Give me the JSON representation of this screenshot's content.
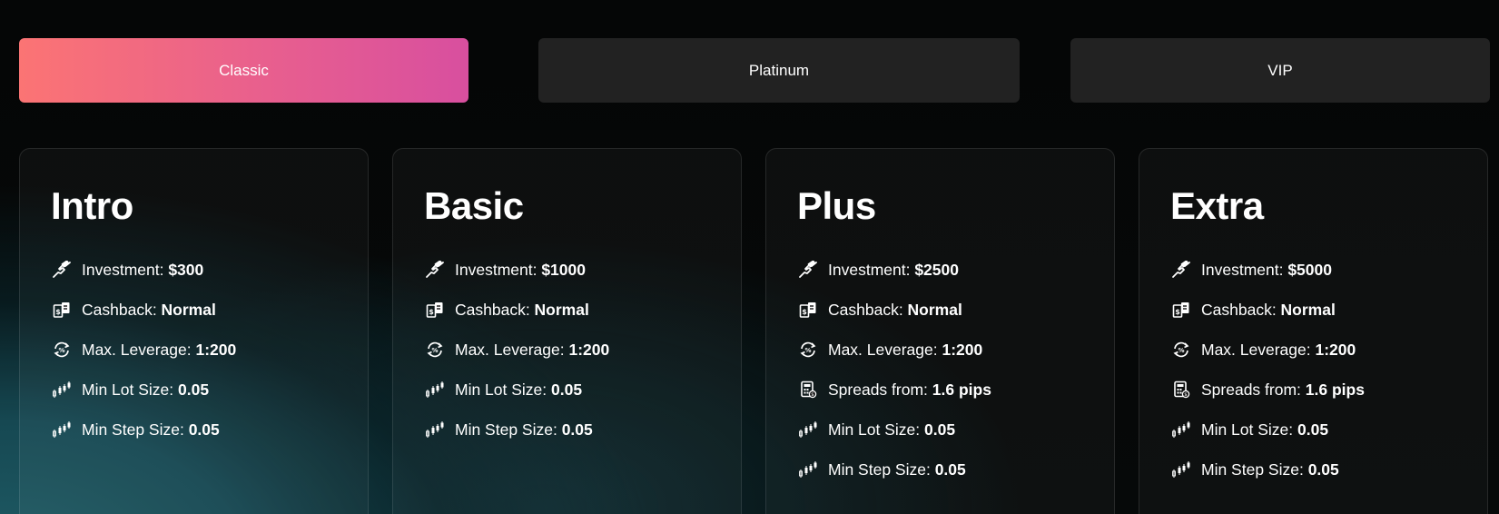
{
  "tabs": [
    {
      "label": "Classic",
      "active": true
    },
    {
      "label": "Platinum",
      "active": false
    },
    {
      "label": "VIP",
      "active": false
    }
  ],
  "colors": {
    "active_tab_gradient": [
      "#fb7474",
      "#d84f9f"
    ],
    "inactive_tab": "#222222",
    "text": "#ffffff"
  },
  "cards": [
    {
      "title": "Intro",
      "features": [
        {
          "icon": "investment-icon",
          "label": "Investment: ",
          "value": "$300"
        },
        {
          "icon": "cashback-icon",
          "label": "Cashback: ",
          "value": "Normal"
        },
        {
          "icon": "leverage-icon",
          "label": "Max. Leverage: ",
          "value": "1:200"
        },
        {
          "icon": "candlestick-icon",
          "label": "Min Lot Size: ",
          "value": "0.05"
        },
        {
          "icon": "candlestick-icon",
          "label": "Min Step Size: ",
          "value": "0.05"
        }
      ]
    },
    {
      "title": "Basic",
      "features": [
        {
          "icon": "investment-icon",
          "label": "Investment: ",
          "value": "$1000"
        },
        {
          "icon": "cashback-icon",
          "label": "Cashback: ",
          "value": "Normal"
        },
        {
          "icon": "leverage-icon",
          "label": "Max. Leverage: ",
          "value": "1:200"
        },
        {
          "icon": "candlestick-icon",
          "label": "Min Lot Size: ",
          "value": "0.05"
        },
        {
          "icon": "candlestick-icon",
          "label": "Min Step Size: ",
          "value": "0.05"
        }
      ]
    },
    {
      "title": "Plus",
      "features": [
        {
          "icon": "investment-icon",
          "label": "Investment: ",
          "value": "$2500"
        },
        {
          "icon": "cashback-icon",
          "label": "Cashback: ",
          "value": "Normal"
        },
        {
          "icon": "leverage-icon",
          "label": "Max. Leverage: ",
          "value": "1:200"
        },
        {
          "icon": "calculator-icon",
          "label": "Spreads from: ",
          "value": "1.6 pips"
        },
        {
          "icon": "candlestick-icon",
          "label": "Min Lot Size: ",
          "value": "0.05"
        },
        {
          "icon": "candlestick-icon",
          "label": "Min Step Size: ",
          "value": "0.05"
        }
      ]
    },
    {
      "title": "Extra",
      "features": [
        {
          "icon": "investment-icon",
          "label": "Investment: ",
          "value": "$5000"
        },
        {
          "icon": "cashback-icon",
          "label": "Cashback: ",
          "value": "Normal"
        },
        {
          "icon": "leverage-icon",
          "label": "Max. Leverage: ",
          "value": "1:200"
        },
        {
          "icon": "calculator-icon",
          "label": "Spreads from: ",
          "value": "1.6 pips"
        },
        {
          "icon": "candlestick-icon",
          "label": "Min Lot Size: ",
          "value": "0.05"
        },
        {
          "icon": "candlestick-icon",
          "label": "Min Step Size: ",
          "value": "0.05"
        }
      ]
    }
  ]
}
